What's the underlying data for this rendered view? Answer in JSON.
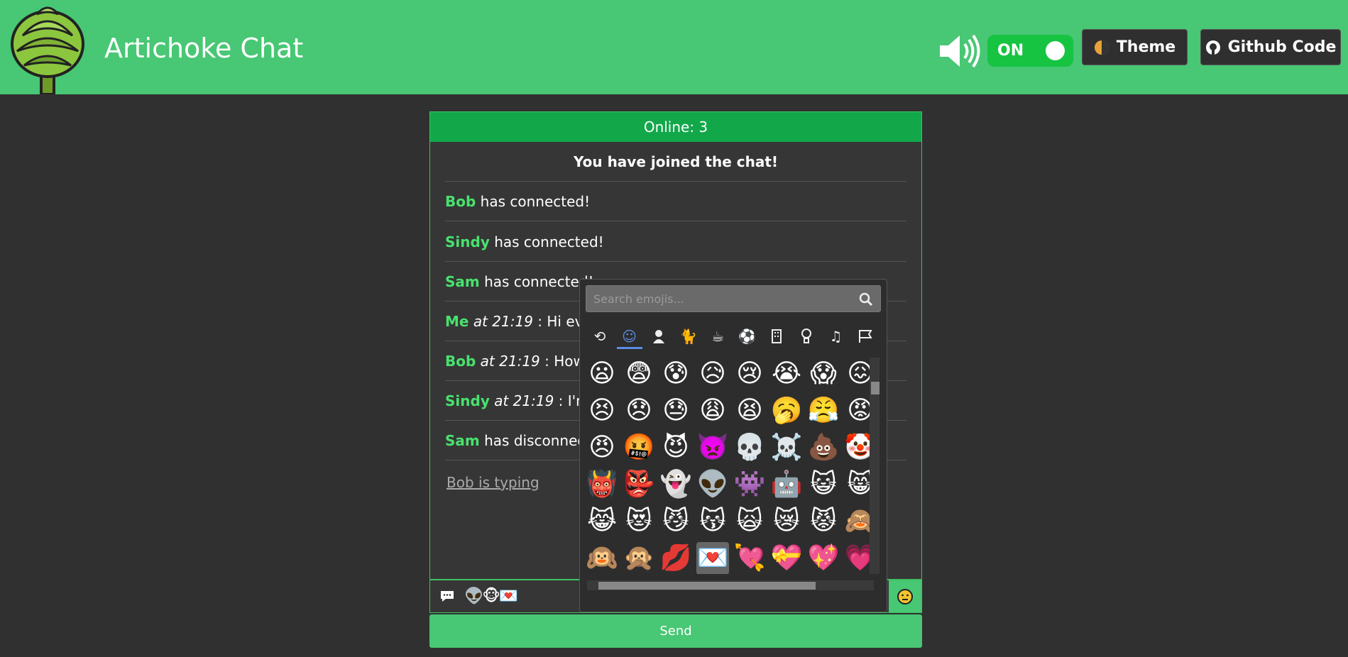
{
  "header": {
    "title": "Artichoke Chat",
    "sound_toggle": "ON",
    "theme_button": "Theme",
    "github_button": "Github Code"
  },
  "chat": {
    "online": "Online: 3",
    "joined": "You have joined the chat!",
    "messages": [
      {
        "name": "Bob",
        "text": " has connected!"
      },
      {
        "name": "Sindy",
        "text": " has connected!"
      },
      {
        "name": "Sam",
        "text": " has connected!"
      },
      {
        "name": "Me",
        "at": " at 21:19",
        "text": " : Hi ever"
      },
      {
        "name": "Bob",
        "at": " at 21:19",
        "text": " : How a"
      },
      {
        "name": "Sindy",
        "at": " at 21:19",
        "text": " : I'm g"
      },
      {
        "name": "Sam",
        "text": " has disconnecte"
      }
    ],
    "typing": "Bob is typing"
  },
  "input": {
    "value": "👽🐵💌",
    "send_label": "Send"
  },
  "emoji_picker": {
    "search_placeholder": "Search emojis...",
    "categories": [
      "recent-icon",
      "smiley-icon",
      "person-icon",
      "animal-icon",
      "food-icon",
      "activity-icon",
      "building-icon",
      "object-icon",
      "symbol-icon",
      "flag-icon"
    ],
    "active_category": "smiley-icon",
    "rows": [
      [
        "😦",
        "😨",
        "😰",
        "😥",
        "😢",
        "😭",
        "😱",
        "😖"
      ],
      [
        "😣",
        "😞",
        "😓",
        "😩",
        "😫",
        "🥱",
        "😤",
        "😡"
      ],
      [
        "😠",
        "🤬",
        "😈",
        "👿",
        "💀",
        "☠️",
        "💩",
        "🤡"
      ],
      [
        "👹",
        "👺",
        "👻",
        "👽",
        "👾",
        "🤖",
        "😺",
        "😸"
      ],
      [
        "😹",
        "😻",
        "😼",
        "😽",
        "🙀",
        "😿",
        "😾",
        "🙈"
      ],
      [
        "🙉",
        "🙊",
        "💋",
        "💌",
        "💘",
        "💝",
        "💖",
        "💗"
      ]
    ],
    "selected": "💌"
  }
}
